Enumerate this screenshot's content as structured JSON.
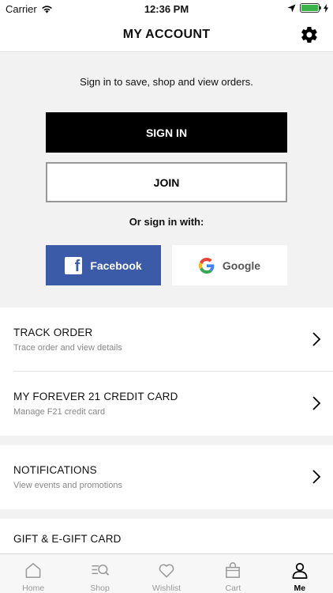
{
  "status_bar": {
    "carrier": "Carrier",
    "time": "12:36 PM"
  },
  "header": {
    "title": "MY ACCOUNT",
    "settings_icon": "gear-icon"
  },
  "signin": {
    "prompt": "Sign in to save, shop and view orders.",
    "signin_label": "SIGN IN",
    "join_label": "JOIN",
    "alt_prompt": "Or sign in with:",
    "facebook_label": "Facebook",
    "google_label": "Google"
  },
  "menu": {
    "track_order": {
      "title": "TRACK ORDER",
      "subtitle": "Trace order and view details"
    },
    "credit_card": {
      "title": "MY FOREVER 21 CREDIT CARD",
      "subtitle": "Manage F21 credit card"
    },
    "notifications": {
      "title": "NOTIFICATIONS",
      "subtitle": "View events and promotions"
    },
    "gift_card": {
      "title": "GIFT & E-GIFT CARD"
    }
  },
  "tabs": [
    {
      "label": "Home",
      "icon": "home-icon"
    },
    {
      "label": "Shop",
      "icon": "shop-search-icon"
    },
    {
      "label": "Wishlist",
      "icon": "heart-icon"
    },
    {
      "label": "Cart",
      "icon": "bag-icon"
    },
    {
      "label": "Me",
      "icon": "person-icon",
      "active": true
    }
  ],
  "colors": {
    "facebook": "#3b5ba9",
    "battery": "#3bb54a",
    "primary_button": "#000000"
  }
}
